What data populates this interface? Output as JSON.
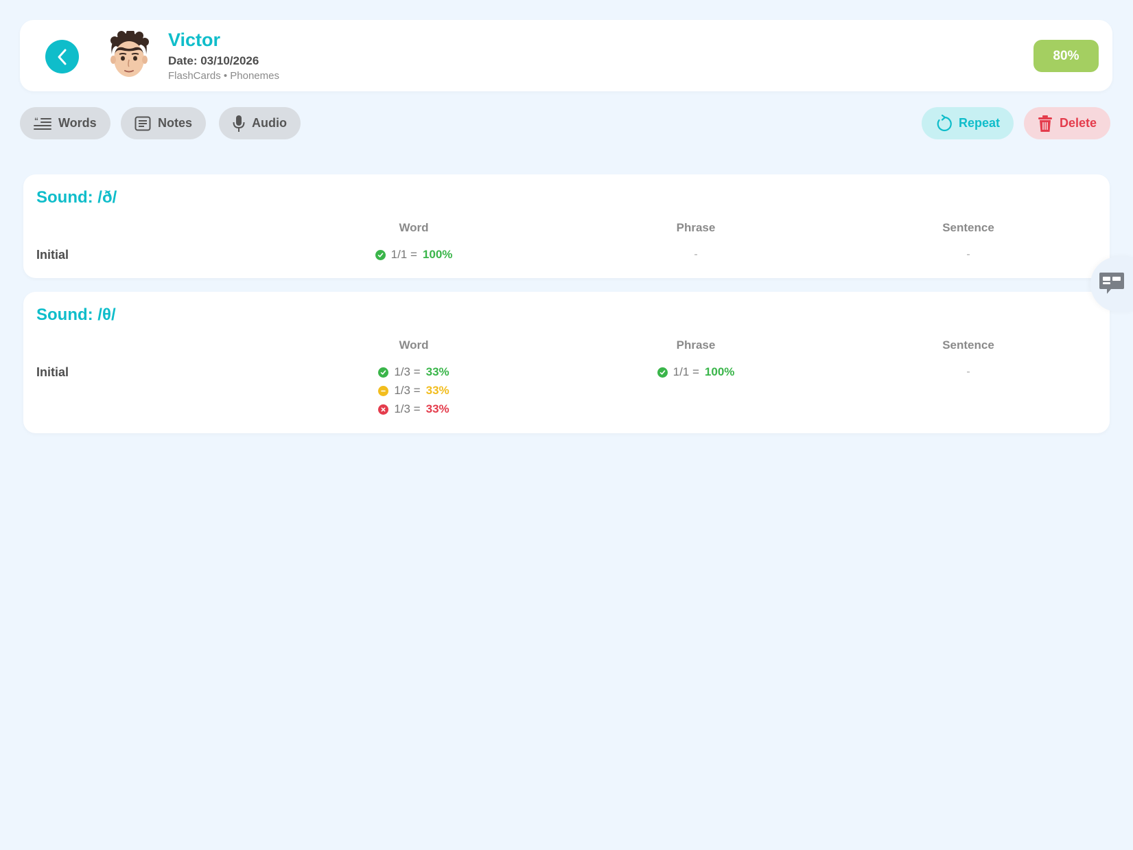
{
  "header": {
    "patient_name": "Victor",
    "date": "Date: 03/10/2026",
    "meta": "FlashCards • Phonemes",
    "score": "80%"
  },
  "toolbar": {
    "words_label": "Words",
    "notes_label": "Notes",
    "audio_label": "Audio",
    "repeat_label": "Repeat",
    "delete_label": "Delete"
  },
  "colors": {
    "accent": "#0fbdca",
    "score_bg": "#a4cf61",
    "correct": "#3ab54a",
    "partial": "#f2bd1e",
    "incorrect": "#e43c4c",
    "background": "#eef6fe"
  },
  "sounds": [
    {
      "title": "Sound: /ð/",
      "columns": [
        "Word",
        "Phrase",
        "Sentence"
      ],
      "rows": [
        {
          "label": "Initial",
          "word": [
            {
              "status": "correct",
              "fraction": "1/1 =",
              "percent": "100%"
            }
          ],
          "phrase": "-",
          "sentence": "-"
        }
      ]
    },
    {
      "title": "Sound: /θ/",
      "columns": [
        "Word",
        "Phrase",
        "Sentence"
      ],
      "rows": [
        {
          "label": "Initial",
          "word": [
            {
              "status": "correct",
              "fraction": "1/3 =",
              "percent": "33%"
            },
            {
              "status": "partial",
              "fraction": "1/3 =",
              "percent": "33%"
            },
            {
              "status": "incorrect",
              "fraction": "1/3 =",
              "percent": "33%"
            }
          ],
          "phrase": [
            {
              "status": "correct",
              "fraction": "1/1 =",
              "percent": "100%"
            }
          ],
          "sentence": "-"
        }
      ]
    }
  ]
}
